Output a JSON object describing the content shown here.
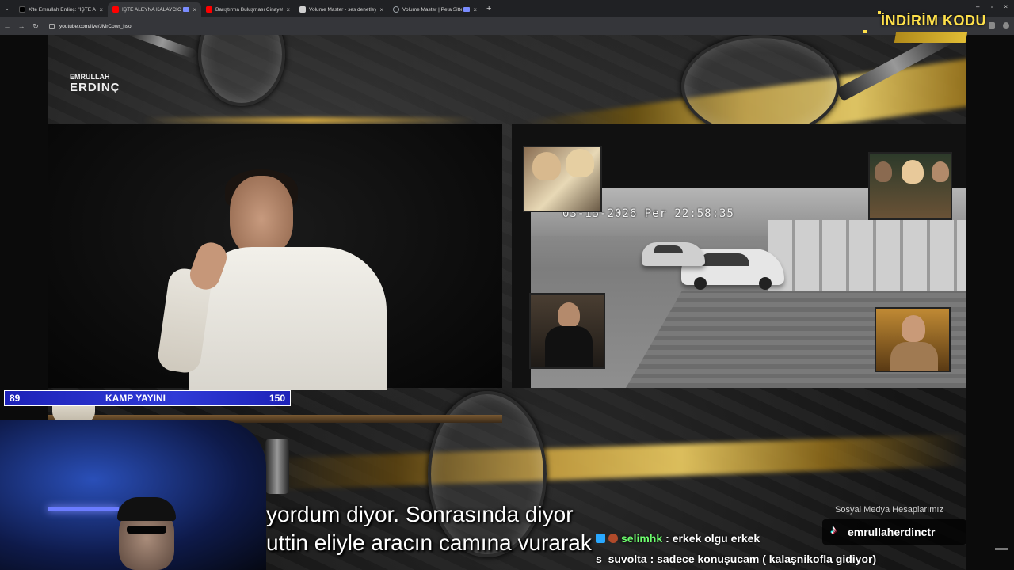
{
  "browser": {
    "tabs": [
      {
        "title": "X'te Emrullah Erdinç: \"İŞTE ALEYNA\"",
        "favicon": "x-icon",
        "color": "#000000",
        "active": false
      },
      {
        "title": "İŞTE ALEYNA KALAYCIOĞLU",
        "favicon": "youtube-icon",
        "color": "#ff0000",
        "active": true
      },
      {
        "title": "Barıştırma Buluşması Cinayetle",
        "favicon": "youtube-icon",
        "color": "#ff0000",
        "active": false
      },
      {
        "title": "Volume Master - ses denetleyicisi",
        "favicon": "extension-icon",
        "color": "#cfcfcf",
        "active": false
      },
      {
        "title": "Volume Master | Peta Sittek",
        "favicon": "globe-icon",
        "color": "#9aa0a6",
        "active": false
      }
    ],
    "new_tab": "+",
    "url": "youtube.com/live/JMrCowr_hso"
  },
  "overlay": {
    "logo_top": "EMRULLAH",
    "logo_bottom": "ERDINÇ",
    "promo": "İNDİRİM KODU",
    "cctv_timestamp": "03-15-2026 Per 22:58:35",
    "counter": {
      "left": "89",
      "label": "KAMP YAYINI",
      "right": "150"
    },
    "subtitles": [
      "yordum diyor. Sonrasında diyor",
      "uttin eliyle aracın camına vurarak"
    ],
    "chat": [
      {
        "user": "selimhk",
        "message": ": erkek olgu erkek",
        "user_color": "#6dff6d"
      },
      {
        "user": "s_suvolta",
        "message": ": sadece konuşucam ( kalaşnikofla gidiyor)",
        "user_color": "#ffffff"
      }
    ],
    "social_label": "Sosyal Medya Hesaplarımız",
    "social_handle": "emrullaherdinctr"
  },
  "colors": {
    "accent_gold": "#d8b247",
    "counter_blue": "#2f3ad6",
    "promo_yellow": "#ffe14a"
  }
}
